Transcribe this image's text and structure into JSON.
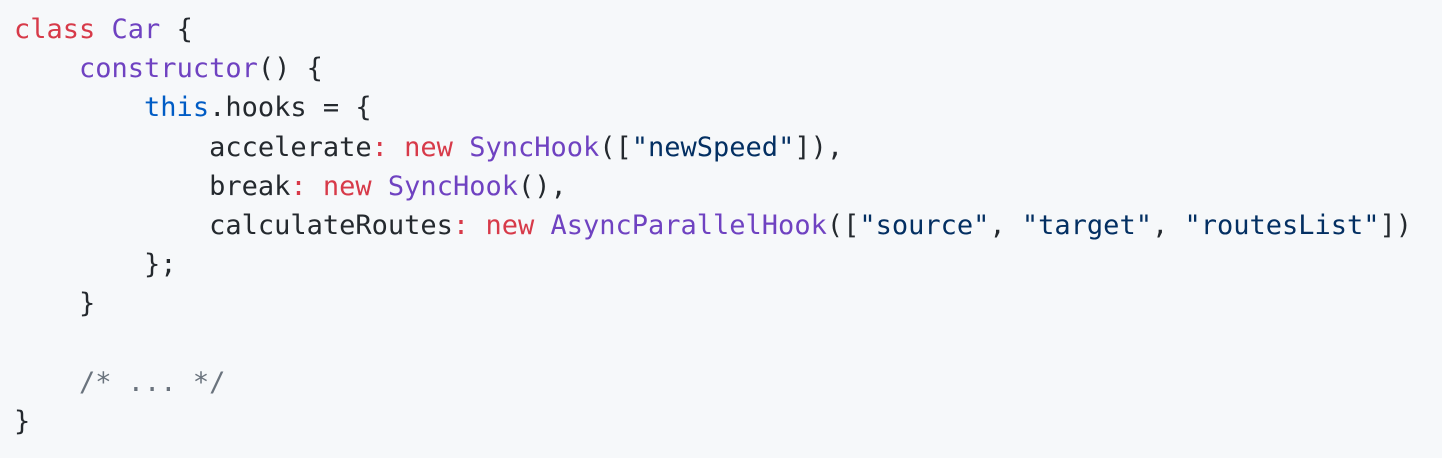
{
  "code": {
    "language": "javascript",
    "colors": {
      "background": "#f6f8fa",
      "keyword": "#d73a49",
      "entity": "#6f42c1",
      "constant": "#005cc5",
      "string": "#032f62",
      "text": "#24292e",
      "comment": "#6a737d"
    },
    "lines": [
      [
        {
          "t": "class",
          "k": "kw"
        },
        {
          "t": " ",
          "k": "plain"
        },
        {
          "t": "Car",
          "k": "cls"
        },
        {
          "t": " {",
          "k": "plain"
        }
      ],
      [
        {
          "t": "    ",
          "k": "plain"
        },
        {
          "t": "constructor",
          "k": "fn"
        },
        {
          "t": "() {",
          "k": "plain"
        }
      ],
      [
        {
          "t": "        ",
          "k": "plain"
        },
        {
          "t": "this",
          "k": "const"
        },
        {
          "t": ".hooks = {",
          "k": "plain"
        }
      ],
      [
        {
          "t": "            accelerate",
          "k": "plain"
        },
        {
          "t": ":",
          "k": "kw"
        },
        {
          "t": " ",
          "k": "plain"
        },
        {
          "t": "new",
          "k": "kw"
        },
        {
          "t": " ",
          "k": "plain"
        },
        {
          "t": "SyncHook",
          "k": "fn"
        },
        {
          "t": "([",
          "k": "plain"
        },
        {
          "t": "\"newSpeed\"",
          "k": "str"
        },
        {
          "t": "]),",
          "k": "plain"
        }
      ],
      [
        {
          "t": "            break",
          "k": "plain"
        },
        {
          "t": ":",
          "k": "kw"
        },
        {
          "t": " ",
          "k": "plain"
        },
        {
          "t": "new",
          "k": "kw"
        },
        {
          "t": " ",
          "k": "plain"
        },
        {
          "t": "SyncHook",
          "k": "fn"
        },
        {
          "t": "(),",
          "k": "plain"
        }
      ],
      [
        {
          "t": "            calculateRoutes",
          "k": "plain"
        },
        {
          "t": ":",
          "k": "kw"
        },
        {
          "t": " ",
          "k": "plain"
        },
        {
          "t": "new",
          "k": "kw"
        },
        {
          "t": " ",
          "k": "plain"
        },
        {
          "t": "AsyncParallelHook",
          "k": "fn"
        },
        {
          "t": "([",
          "k": "plain"
        },
        {
          "t": "\"source\"",
          "k": "str"
        },
        {
          "t": ", ",
          "k": "plain"
        },
        {
          "t": "\"target\"",
          "k": "str"
        },
        {
          "t": ", ",
          "k": "plain"
        },
        {
          "t": "\"routesList\"",
          "k": "str"
        },
        {
          "t": "])",
          "k": "plain"
        }
      ],
      [
        {
          "t": "        };",
          "k": "plain"
        }
      ],
      [
        {
          "t": "    }",
          "k": "plain"
        }
      ],
      [],
      [
        {
          "t": "    ",
          "k": "plain"
        },
        {
          "t": "/* ... */",
          "k": "cmt"
        }
      ],
      [
        {
          "t": "}",
          "k": "plain"
        }
      ]
    ]
  }
}
